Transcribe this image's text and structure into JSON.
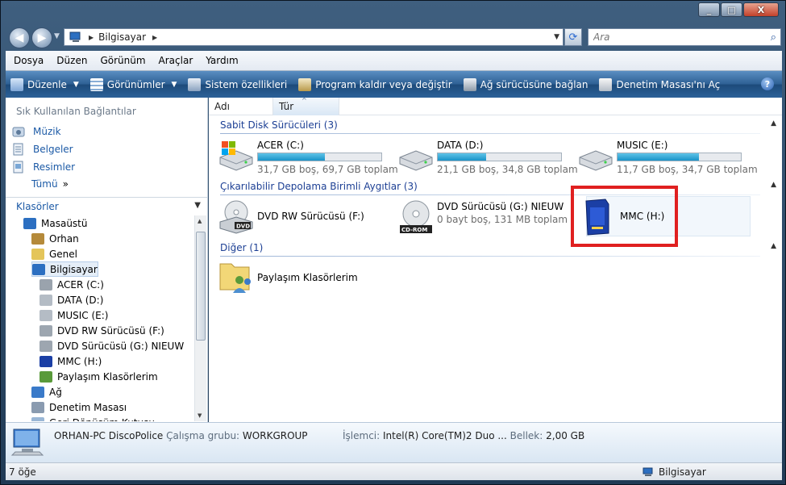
{
  "window": {
    "min": "_",
    "max": "□",
    "close": "X"
  },
  "nav": {
    "breadcrumb": "Bilgisayar",
    "search_placeholder": "Ara"
  },
  "menu": [
    "Dosya",
    "Düzen",
    "Görünüm",
    "Araçlar",
    "Yardım"
  ],
  "commands": [
    {
      "label": "Düzenle",
      "icon": "organize-icon",
      "has_dropdown": true
    },
    {
      "label": "Görünümler",
      "icon": "views-icon",
      "has_dropdown": true
    },
    {
      "label": "Sistem özellikleri",
      "icon": "system-properties-icon",
      "has_dropdown": false
    },
    {
      "label": "Program kaldır veya değiştir",
      "icon": "uninstall-icon",
      "has_dropdown": false
    },
    {
      "label": "Ağ sürücüsüne bağlan",
      "icon": "map-network-drive-icon",
      "has_dropdown": false
    },
    {
      "label": "Denetim Masası'nı Aç",
      "icon": "control-panel-icon",
      "has_dropdown": false
    }
  ],
  "favorites": {
    "title": "Sık Kullanılan Bağlantılar",
    "items": [
      "Müzik",
      "Belgeler",
      "Resimler"
    ],
    "more": "Tümü",
    "more_chevron": "»"
  },
  "folders": {
    "title": "Klasörler",
    "tree": [
      {
        "label": "Masaüstü",
        "level": 0,
        "icon": "desktop-icon"
      },
      {
        "label": "Orhan",
        "level": 1,
        "icon": "user-folder-icon"
      },
      {
        "label": "Genel",
        "level": 1,
        "icon": "public-folder-icon"
      },
      {
        "label": "Bilgisayar",
        "level": 1,
        "icon": "computer-icon",
        "selected": true
      },
      {
        "label": "ACER (C:)",
        "level": 2,
        "icon": "system-drive-icon"
      },
      {
        "label": "DATA (D:)",
        "level": 2,
        "icon": "hard-drive-icon"
      },
      {
        "label": "MUSIC (E:)",
        "level": 2,
        "icon": "hard-drive-icon"
      },
      {
        "label": "DVD RW Sürücüsü (F:)",
        "level": 2,
        "icon": "dvd-drive-icon"
      },
      {
        "label": "DVD Sürücüsü (G:) NIEUW",
        "level": 2,
        "icon": "dvd-drive-icon"
      },
      {
        "label": "MMC (H:)",
        "level": 2,
        "icon": "memory-card-icon"
      },
      {
        "label": "Paylaşım Klasörlerim",
        "level": 2,
        "icon": "shared-folder-icon"
      },
      {
        "label": "Ağ",
        "level": 1,
        "icon": "network-icon"
      },
      {
        "label": "Denetim Masası",
        "level": 1,
        "icon": "control-panel-icon"
      },
      {
        "label": "Geri Dönüşüm Kutusu",
        "level": 1,
        "icon": "recycle-bin-icon"
      }
    ]
  },
  "columns": [
    "Adı",
    "Tür"
  ],
  "groups": [
    {
      "title": "Sabit Disk Sürücüleri (3)"
    },
    {
      "title": "Çıkarılabilir Depolama Birimli Aygıtlar (3)"
    },
    {
      "title": "Diğer (1)"
    }
  ],
  "drives": [
    {
      "name": "ACER (C:)",
      "info": "31,7 GB boş, 69,7 GB toplam",
      "used_fraction": 0.545
    },
    {
      "name": "DATA (D:)",
      "info": "21,1 GB boş, 34,8 GB toplam",
      "used_fraction": 0.394
    },
    {
      "name": "MUSIC (E:)",
      "info": "11,7 GB boş, 34,7 GB toplam",
      "used_fraction": 0.663
    }
  ],
  "removables": [
    {
      "name": "DVD RW Sürücüsü (F:)",
      "info": ""
    },
    {
      "name": "DVD Sürücüsü (G:) NIEUW",
      "info": "0 bayt boş, 131 MB toplam"
    },
    {
      "name": "MMC (H:)",
      "info": ""
    }
  ],
  "other": [
    {
      "name": "Paylaşım Klasörlerim"
    }
  ],
  "details": {
    "pc_name": "ORHAN-PC DiscoPolice",
    "workgroup_label": "Çalışma grubu:",
    "workgroup": "WORKGROUP",
    "cpu_label": "İşlemci:",
    "cpu": "Intel(R) Core(TM)2 Duo ...",
    "memory_label": "Bellek:",
    "memory": "2,00 GB"
  },
  "status": {
    "count": "7 öğe",
    "location": "Bilgisayar"
  },
  "colors": {
    "accent": "#1c5aa6",
    "highlight": "#e02020",
    "bar_fill": "#1a93c8"
  }
}
